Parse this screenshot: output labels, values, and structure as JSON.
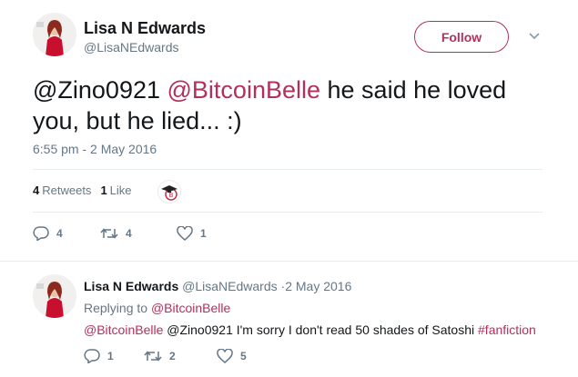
{
  "main_tweet": {
    "author_name": "Lisa N Edwards",
    "author_handle": "@LisaNEdwards",
    "follow_label": "Follow",
    "text_mention_1": "@Zino0921",
    "text_mention_2": "@BitcoinBelle",
    "text_rest": " he said he loved you, but he lied... :)",
    "timestamp": "6:55 pm - 2 May 2016",
    "retweets_count": "4",
    "retweets_label": "Retweets",
    "likes_count": "1",
    "likes_label": "Like",
    "actions": {
      "reply_count": "4",
      "retweet_count": "4",
      "like_count": "1"
    }
  },
  "reply_tweet": {
    "author_name": "Lisa N Edwards",
    "author_handle": "@LisaNEdwards",
    "date": "·2 May 2016",
    "replying_prefix": "Replying to",
    "replying_to": "@BitcoinBelle",
    "text_mention": "@BitcoinBelle",
    "text_body": " @Zino0921 I'm sorry I don't read 50 shades of Satoshi ",
    "text_hashtag": "#fanfiction",
    "actions": {
      "reply_count": "1",
      "retweet_count": "2",
      "like_count": "5"
    }
  },
  "colors": {
    "accent": "#b3305c",
    "muted": "#657786",
    "divider": "#e6ecf0",
    "text": "#14171a"
  }
}
